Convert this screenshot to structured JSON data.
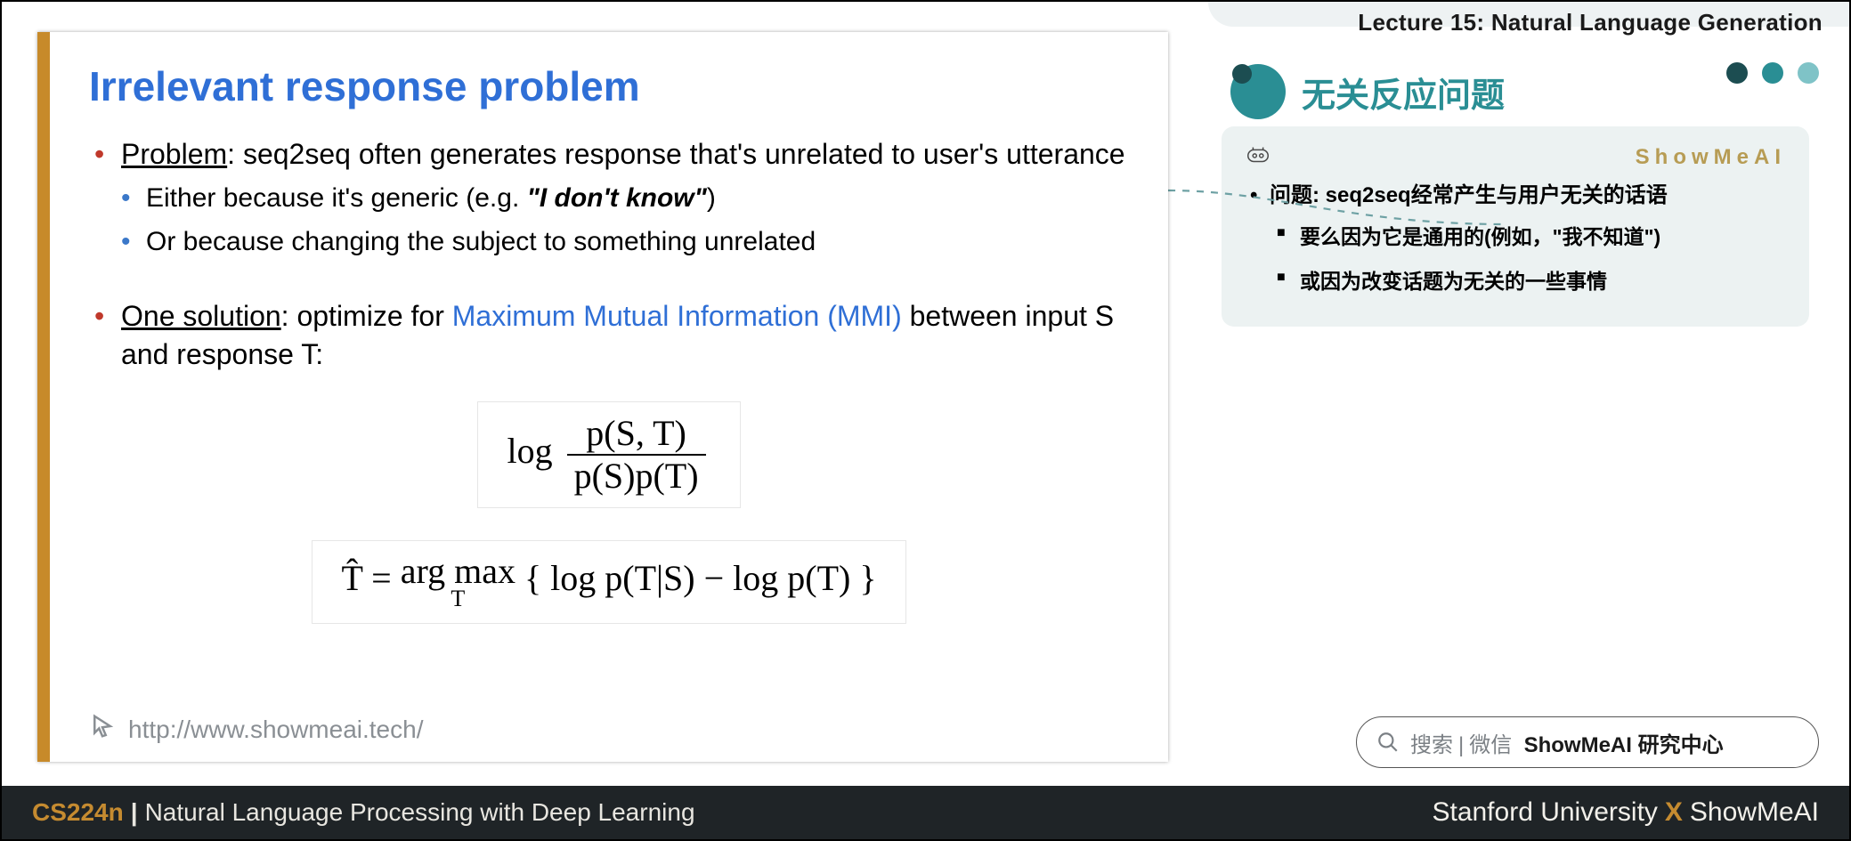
{
  "header": {
    "lecture_label": "Lecture 15: Natural Language Generation"
  },
  "slide": {
    "title": "Irrelevant response problem",
    "b1_label": "Problem",
    "b1_rest": ": seq2seq often generates response that's unrelated to user's utterance",
    "b1a_pre": "Either because it's generic (e.g. ",
    "b1a_quote": "\"I don't know\"",
    "b1a_post": ")",
    "b1b": "Or because changing the subject to something unrelated",
    "b2_label": "One solution",
    "b2_mid": ": optimize for ",
    "b2_link": "Maximum Mutual Information (MMI)",
    "b2_tail": " between input S and response T:",
    "formula1_log": "log",
    "formula1_num": "p(S, T)",
    "formula1_den": "p(S)p(T)",
    "formula2_lhs": "T̂ = ",
    "formula2_argmax": "arg max",
    "formula2_sub": "T",
    "formula2_body": " { log p(T|S) − log p(T) }",
    "footer_url": "http://www.showmeai.tech/"
  },
  "right": {
    "title": "无关反应问题",
    "brand": "ShowMeAI",
    "c1": "问题: seq2seq经常产生与用户无关的话语",
    "c2a": "要么因为它是通用的(例如，\"我不知道\")",
    "c2b": "或因为改变话题为无关的一些事情"
  },
  "search": {
    "word1": "搜索",
    "word2": "微信",
    "strong": "ShowMeAI 研究中心"
  },
  "footer": {
    "course": "CS224n",
    "course_title": "Natural Language Processing with Deep Learning",
    "org1": "Stanford University",
    "org2": "ShowMeAI"
  },
  "colors": {
    "dot1": "#1c4d51",
    "dot2": "#2a8e94",
    "dot3": "#7fc3c7"
  }
}
